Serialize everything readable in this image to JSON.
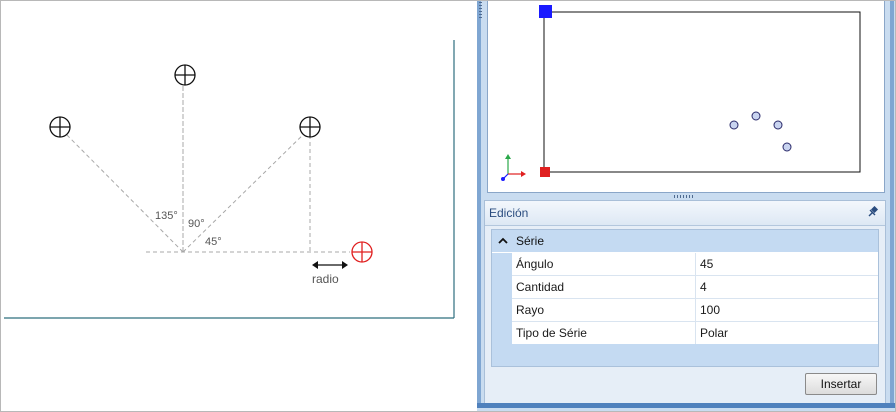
{
  "diagram": {
    "angle_labels": [
      "135°",
      "90°",
      "45°"
    ],
    "radius_label": "radio"
  },
  "colors": {
    "accent_red": "#e02020",
    "accent_blue": "#1a1aff",
    "panel_bg": "#c9dcf0",
    "category_bg": "#c4daf2"
  },
  "edit_panel": {
    "title": "Edición",
    "pin_icon": "pin-icon",
    "category": {
      "label": "Série",
      "expanded": true
    },
    "properties": [
      {
        "name": "Ángulo",
        "value": "45"
      },
      {
        "name": "Cantidad",
        "value": "4"
      },
      {
        "name": "Rayo",
        "value": "100"
      },
      {
        "name": "Tipo de Série",
        "value": "Polar"
      }
    ],
    "insert_label": "Insertar"
  }
}
